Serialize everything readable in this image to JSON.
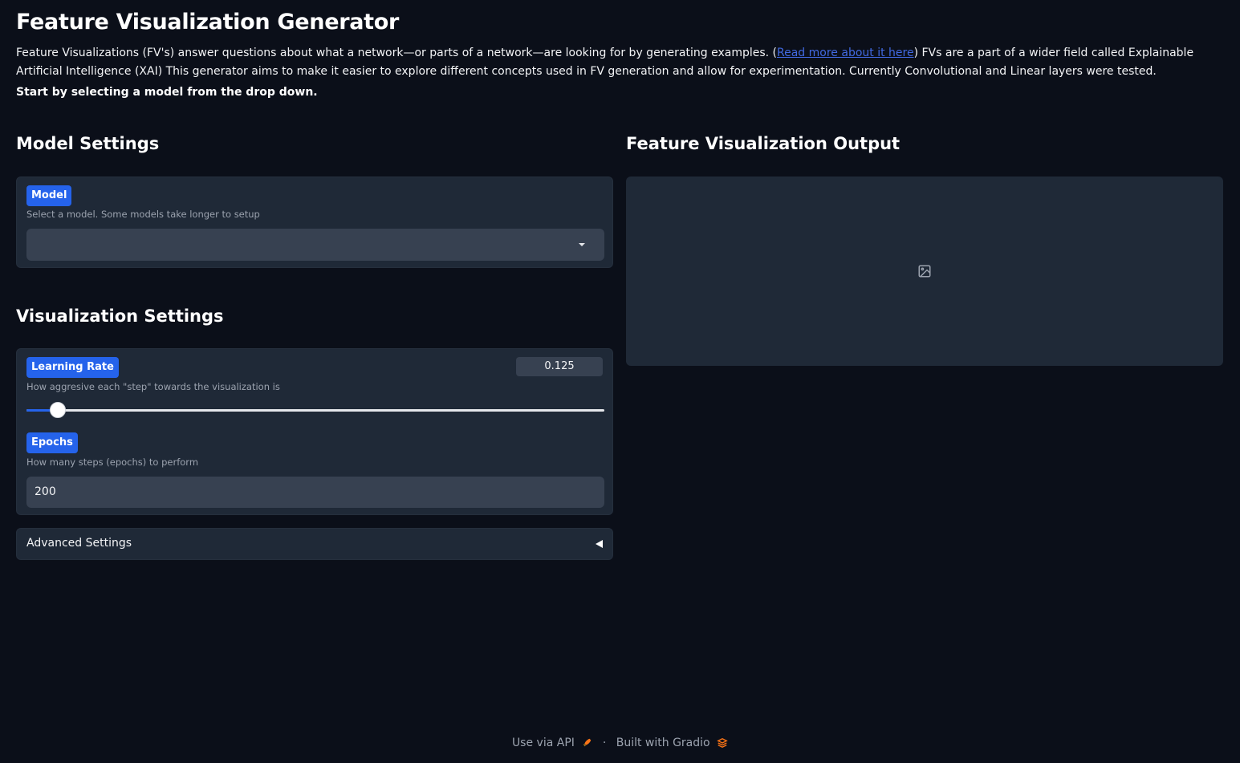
{
  "header": {
    "title": "Feature Visualization Generator",
    "intro_before_link": "Feature Visualizations (FV's) answer questions about what a network—or parts of a network—are looking for by generating examples. (",
    "intro_link_text": "Read more about it here",
    "intro_after_link": ") FVs are a part of a wider field called Explainable Artificial Intelligence (XAI) This generator aims to make it easier to explore different concepts used in FV generation and allow for experimentation. Currently Convolutional and Linear layers were tested.",
    "cta": "Start by selecting a model from the drop down."
  },
  "model_settings": {
    "heading": "Model Settings",
    "model": {
      "label": "Model",
      "info": "Select a model. Some models take longer to setup",
      "selected": ""
    }
  },
  "visualization_settings": {
    "heading": "Visualization Settings",
    "learning_rate": {
      "label": "Learning Rate",
      "info": "How aggresive each \"step\" towards the visualization is",
      "value": "0.125",
      "slider_fraction": 0.054
    },
    "epochs": {
      "label": "Epochs",
      "info": "How many steps (epochs) to perform",
      "value": "200"
    },
    "advanced": {
      "label": "Advanced Settings"
    }
  },
  "output": {
    "heading": "Feature Visualization Output",
    "icon": "image-icon"
  },
  "footer": {
    "api_label": "Use via API",
    "separator": "·",
    "built_with": "Built with Gradio"
  },
  "colors": {
    "background": "#0b0f19",
    "panel": "#1f2937",
    "input": "#374151",
    "accent": "#2563eb",
    "link": "#4169e1"
  }
}
